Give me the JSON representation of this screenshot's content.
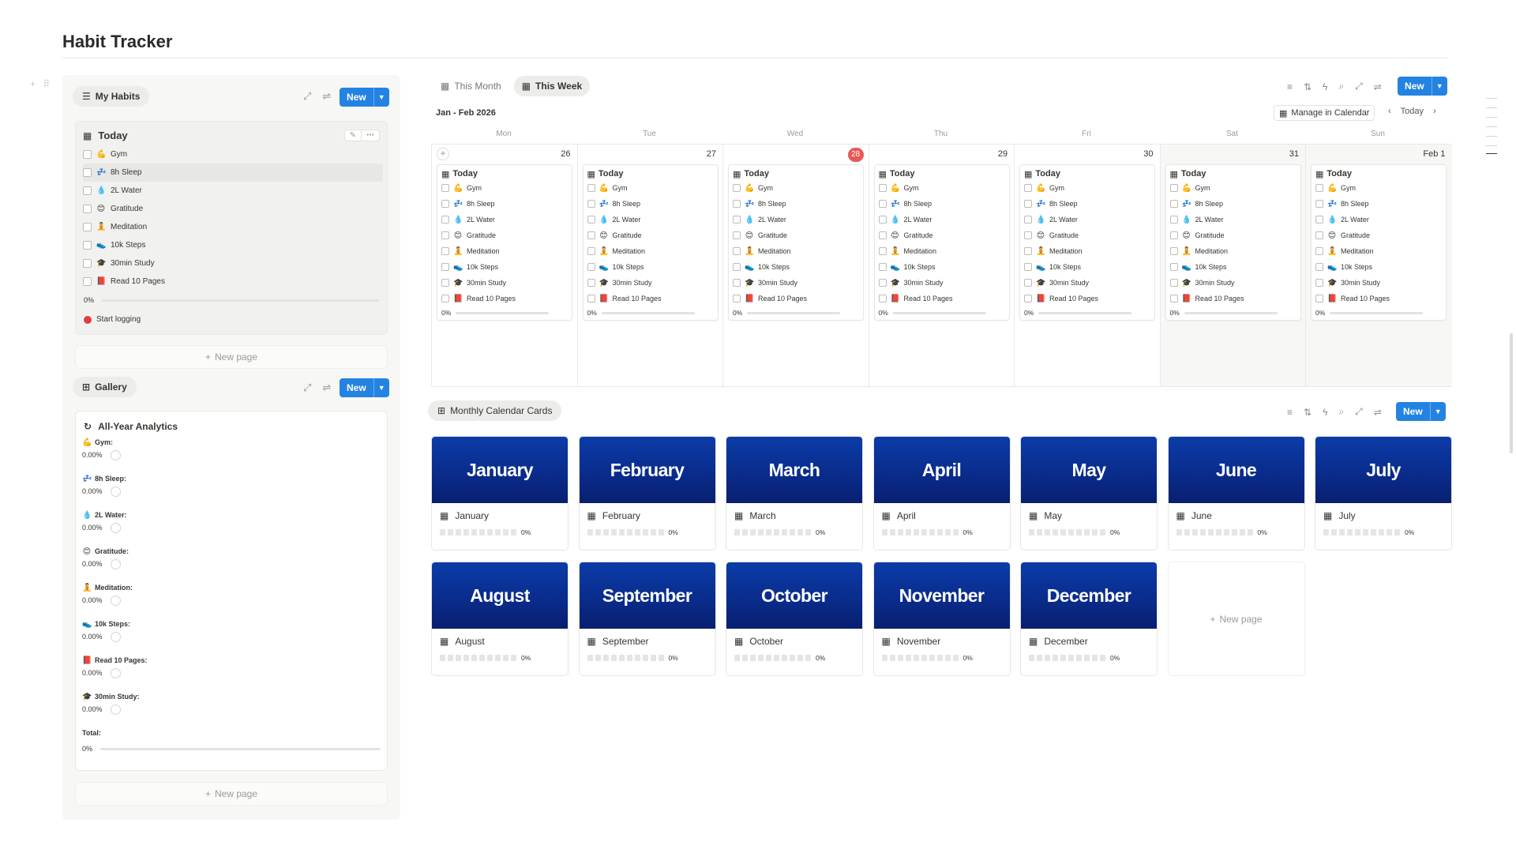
{
  "page": {
    "title": "Habit Tracker"
  },
  "left": {
    "my_habits": {
      "label": "My Habits",
      "new_label": "New"
    },
    "today_card": {
      "title": "Today",
      "habits": [
        {
          "emoji": "💪",
          "label": "Gym"
        },
        {
          "emoji": "💤",
          "label": "8h Sleep"
        },
        {
          "emoji": "💧",
          "label": "2L Water"
        },
        {
          "emoji": "😊",
          "label": "Gratitude"
        },
        {
          "emoji": "🧘",
          "label": "Meditation"
        },
        {
          "emoji": "👟",
          "label": "10k Steps"
        },
        {
          "emoji": "🎓",
          "label": "30min Study"
        },
        {
          "emoji": "📕",
          "label": "Read 10 Pages"
        }
      ],
      "progress": "0%",
      "status": "Start logging",
      "status_color": "#e03e3e"
    },
    "new_page": "New page",
    "gallery": {
      "label": "Gallery",
      "new_label": "New"
    },
    "analytics": {
      "title": "All-Year Analytics",
      "rows": [
        {
          "emoji": "💪",
          "label": "Gym:",
          "value": "0.00%"
        },
        {
          "emoji": "💤",
          "label": "8h Sleep:",
          "value": "0.00%"
        },
        {
          "emoji": "💧",
          "label": "2L Water:",
          "value": "0.00%"
        },
        {
          "emoji": "😊",
          "label": "Gratitude:",
          "value": "0.00%"
        },
        {
          "emoji": "🧘",
          "label": "Meditation:",
          "value": "0.00%"
        },
        {
          "emoji": "👟",
          "label": "10k Steps:",
          "value": "0.00%"
        },
        {
          "emoji": "📕",
          "label": "Read 10 Pages:",
          "value": "0.00%"
        },
        {
          "emoji": "🎓",
          "label": "30min Study:",
          "value": "0.00%"
        }
      ],
      "total_label": "Total:",
      "total_value": "0%"
    },
    "new_page_2": "New page"
  },
  "calendar": {
    "tabs": [
      {
        "label": "This Month"
      },
      {
        "label": "This Week"
      }
    ],
    "range": "Jan - Feb 2026",
    "manage": "Manage in Calendar",
    "today_btn": "Today",
    "new_label": "New",
    "weekdays": [
      "Mon",
      "Tue",
      "Wed",
      "Thu",
      "Fri",
      "Sat",
      "Sun"
    ],
    "days": [
      {
        "num": "26"
      },
      {
        "num": "27"
      },
      {
        "num": "28",
        "today": true
      },
      {
        "num": "29"
      },
      {
        "num": "30"
      },
      {
        "num": "31"
      },
      {
        "num": "Feb 1"
      }
    ],
    "today_color": "#eb5757",
    "card_title": "Today",
    "card_progress": "0%"
  },
  "monthly": {
    "label": "Monthly Calendar Cards",
    "new_label": "New",
    "months": [
      "January",
      "February",
      "March",
      "April",
      "May",
      "June",
      "July",
      "August",
      "September",
      "October",
      "November",
      "December"
    ],
    "progress": "0%",
    "new_page": "New page"
  }
}
